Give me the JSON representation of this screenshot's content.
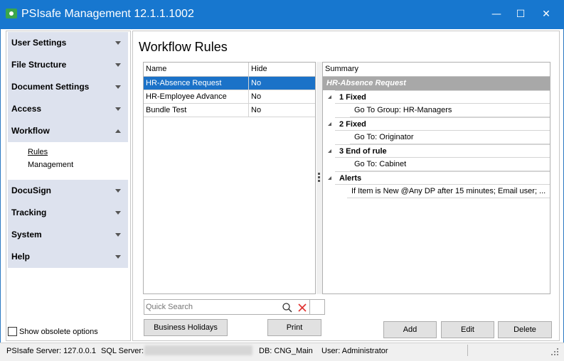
{
  "window": {
    "title": "PSIsafe Management 12.1.1.1002",
    "controls": {
      "minimize": "—",
      "maximize": "☐",
      "close": "✕"
    }
  },
  "sidebar": {
    "groups_top": [
      {
        "label": "User Settings",
        "expanded": false
      },
      {
        "label": "File Structure",
        "expanded": false
      },
      {
        "label": "Document Settings",
        "expanded": false
      },
      {
        "label": "Access",
        "expanded": false
      },
      {
        "label": "Workflow",
        "expanded": true
      }
    ],
    "workflow_items": [
      {
        "label": "Rules",
        "active": true
      },
      {
        "label": "Management",
        "active": false
      }
    ],
    "groups_bottom": [
      {
        "label": "DocuSign",
        "expanded": false
      },
      {
        "label": "Tracking",
        "expanded": false
      },
      {
        "label": "System",
        "expanded": false
      },
      {
        "label": "Help",
        "expanded": false
      }
    ],
    "show_obsolete_label": "Show obsolete options",
    "show_obsolete_checked": false
  },
  "main": {
    "title": "Workflow Rules",
    "rules_table": {
      "columns": [
        "Name",
        "Hide"
      ],
      "rows": [
        {
          "name": "HR-Absence Request",
          "hide": "No",
          "selected": true
        },
        {
          "name": "HR-Employee Advance",
          "hide": "No",
          "selected": false
        },
        {
          "name": "Bundle Test",
          "hide": "No",
          "selected": false
        }
      ]
    },
    "summary": {
      "header": "Summary",
      "title": "HR-Absence Request",
      "groups": [
        {
          "label": "1 Fixed",
          "detail": "Go To Group: HR-Managers"
        },
        {
          "label": "2 Fixed",
          "detail": "Go To: Originator"
        },
        {
          "label": "3 End of rule",
          "detail": "Go To: Cabinet"
        },
        {
          "label": "Alerts",
          "detail": "If Item is New @Any DP after  15 minutes;  Email user; ..."
        }
      ]
    },
    "search": {
      "placeholder": "Quick Search"
    },
    "buttons": {
      "business_holidays": "Business Holidays",
      "print": "Print",
      "add": "Add",
      "edit": "Edit",
      "delete": "Delete"
    }
  },
  "statusbar": {
    "server": "PSIsafe Server: 127.0.0.1",
    "sql_label": "SQL Server:",
    "db": "DB: CNG_Main",
    "user": "User: Administrator"
  }
}
